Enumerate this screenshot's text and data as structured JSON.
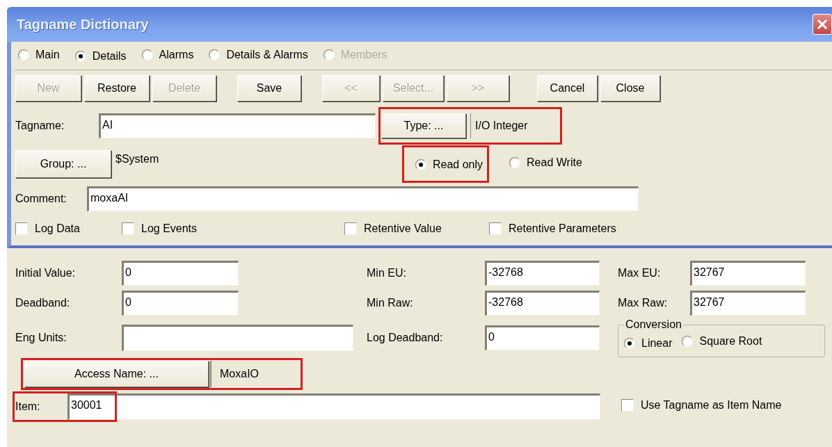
{
  "window": {
    "title": "Tagname Dictionary"
  },
  "view_options": [
    {
      "label": "Main",
      "selected": false,
      "disabled": false
    },
    {
      "label": "Details",
      "selected": true,
      "disabled": false
    },
    {
      "label": "Alarms",
      "selected": false,
      "disabled": false
    },
    {
      "label": "Details & Alarms",
      "selected": false,
      "disabled": false
    },
    {
      "label": "Members",
      "selected": false,
      "disabled": true
    }
  ],
  "toolbar": [
    {
      "label": "New",
      "disabled": true
    },
    {
      "label": "Restore",
      "disabled": false
    },
    {
      "label": "Delete",
      "disabled": true
    },
    {
      "label": "Save",
      "disabled": false
    },
    {
      "label": "<<",
      "disabled": true
    },
    {
      "label": "Select...",
      "disabled": true
    },
    {
      "label": ">>",
      "disabled": true
    },
    {
      "label": "Cancel",
      "disabled": false
    },
    {
      "label": "Close",
      "disabled": false
    }
  ],
  "tagname": {
    "label": "Tagname:",
    "value": "AI"
  },
  "type": {
    "button": "Type: ...",
    "value": "I/O Integer",
    "highlighted": true
  },
  "group": {
    "button": "Group: ...",
    "value": "$System"
  },
  "access_mode": [
    {
      "label": "Read only",
      "selected": true,
      "highlighted": true
    },
    {
      "label": "Read Write",
      "selected": false,
      "highlighted": false
    }
  ],
  "comment": {
    "label": "Comment:",
    "value": "moxaAI"
  },
  "options": [
    {
      "label": "Log Data",
      "checked": false
    },
    {
      "label": "Log Events",
      "checked": false
    },
    {
      "label": "Retentive Value",
      "checked": false
    },
    {
      "label": "Retentive Parameters",
      "checked": false
    }
  ],
  "initial_value": {
    "label": "Initial Value:",
    "value": "0"
  },
  "min_eu": {
    "label": "Min EU:",
    "value": "-32768"
  },
  "max_eu": {
    "label": "Max EU:",
    "value": "32767"
  },
  "deadband": {
    "label": "Deadband:",
    "value": "0"
  },
  "min_raw": {
    "label": "Min Raw:",
    "value": "-32768"
  },
  "max_raw": {
    "label": "Max Raw:",
    "value": "32767"
  },
  "eng_units": {
    "label": "Eng Units:"
  },
  "log_deadband": {
    "label": "Log Deadband:",
    "value": "0"
  },
  "conversion": {
    "title": "Conversion",
    "options": [
      {
        "label": "Linear",
        "selected": true
      },
      {
        "label": "Square Root",
        "selected": false
      }
    ]
  },
  "access_name": {
    "button": "Access Name: ...",
    "value": "MoxaIO",
    "highlighted": true
  },
  "item": {
    "label": "Item:",
    "value": "30001",
    "highlighted": true
  },
  "use_tagname": {
    "label": "Use Tagname as Item Name",
    "checked": false
  }
}
